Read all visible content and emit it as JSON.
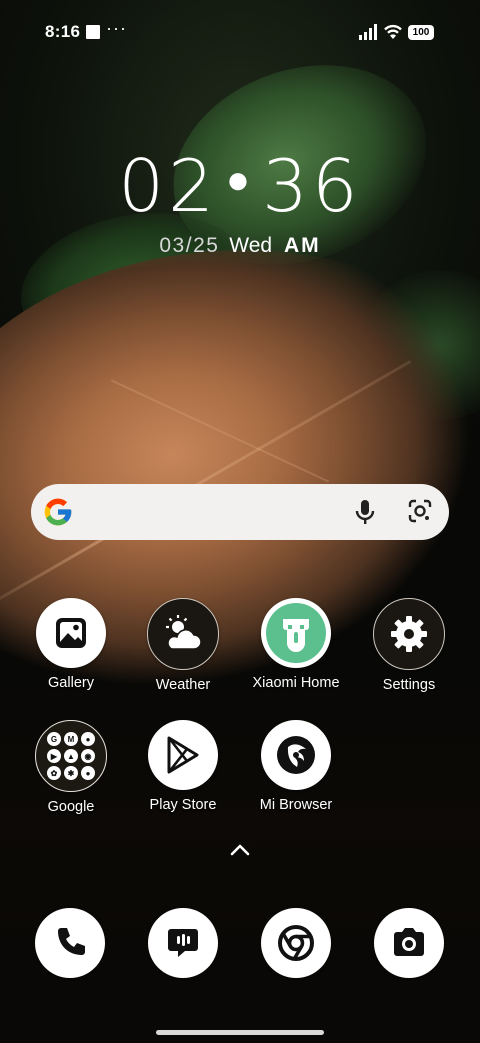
{
  "status_bar": {
    "time": "8:16",
    "extra": "···",
    "battery": "100"
  },
  "lock_clock": {
    "hours": "02",
    "minutes": "36",
    "date": "03/25",
    "weekday": "Wed",
    "ampm": "AM"
  },
  "search": {
    "logo": "google-g-icon",
    "mic": "microphone-icon",
    "lens": "lens-icon"
  },
  "apps": [
    {
      "label": "Gallery",
      "icon": "gallery-icon"
    },
    {
      "label": "Weather",
      "icon": "weather-icon"
    },
    {
      "label": "Xiaomi Home",
      "icon": "xiaomi-home-icon"
    },
    {
      "label": "Settings",
      "icon": "gear-icon"
    },
    {
      "label": "Google",
      "icon": "folder-icon"
    },
    {
      "label": "Play Store",
      "icon": "play-store-icon"
    },
    {
      "label": "Mi Browser",
      "icon": "browser-icon"
    }
  ],
  "dock": [
    {
      "icon": "phone-icon"
    },
    {
      "icon": "messages-icon"
    },
    {
      "icon": "chrome-icon"
    },
    {
      "icon": "camera-icon"
    }
  ],
  "colors": {
    "xiaomi_green": "#5cc08e",
    "search_bg": "#f3f1ef"
  }
}
